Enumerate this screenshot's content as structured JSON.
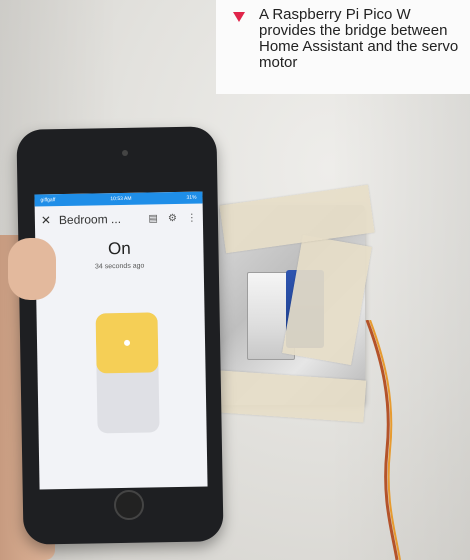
{
  "caption": {
    "text": "A Raspberry Pi Pico W provides the bridge between Home Assistant and the servo motor",
    "arrow_color": "#e0254a"
  },
  "phone_screen": {
    "statusbar_left": "giffgaff",
    "statusbar_time": "10:53 AM",
    "statusbar_right": "31%",
    "app_title": "Bedroom ...",
    "state": "On",
    "last_changed": "34 seconds ago",
    "toggle_on": true,
    "toggle_color": "#f5cf56"
  }
}
